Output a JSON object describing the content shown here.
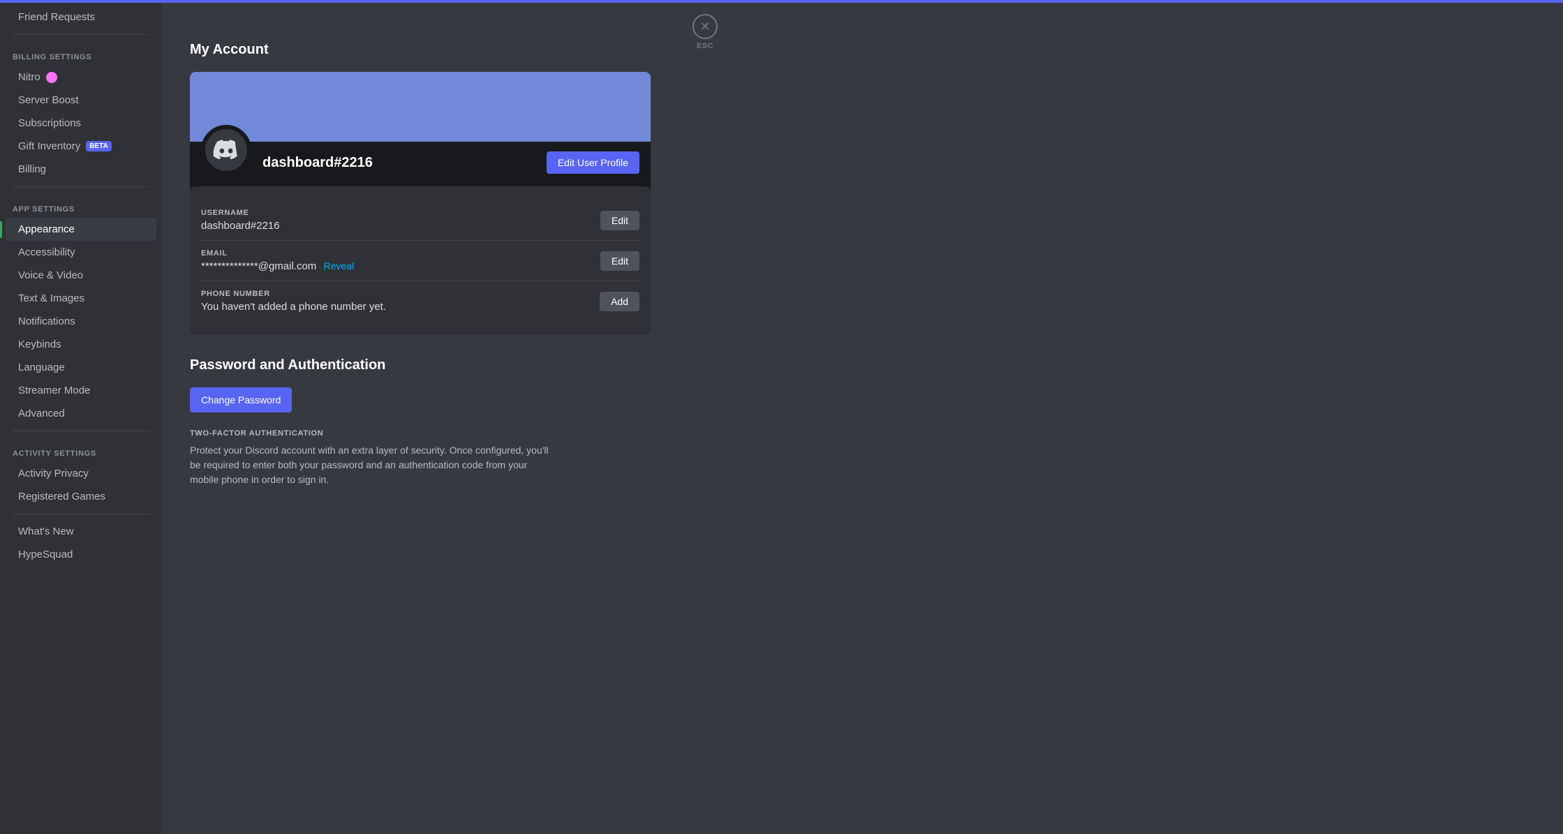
{
  "topbar": {
    "color": "#5865f2"
  },
  "sidebar": {
    "friend_requests": "Friend Requests",
    "billing_section": "Billing Settings",
    "nitro": "Nitro",
    "server_boost": "Server Boost",
    "subscriptions": "Subscriptions",
    "gift_inventory": "Gift Inventory",
    "beta_label": "BETA",
    "billing": "Billing",
    "app_section": "App Settings",
    "appearance": "Appearance",
    "accessibility": "Accessibility",
    "voice_video": "Voice & Video",
    "text_images": "Text & Images",
    "notifications": "Notifications",
    "keybinds": "Keybinds",
    "language": "Language",
    "streamer_mode": "Streamer Mode",
    "advanced": "Advanced",
    "activity_section": "Activity Settings",
    "activity_privacy": "Activity Privacy",
    "registered_games": "Registered Games",
    "whats_new": "What's New",
    "hypesquad": "HypeSquad"
  },
  "main": {
    "page_title": "My Account",
    "username": "dashboard#2216",
    "edit_profile_btn": "Edit User Profile",
    "fields": {
      "username_label": "USERNAME",
      "username_value": "dashboard#2216",
      "username_edit": "Edit",
      "email_label": "EMAIL",
      "email_value": "**************@gmail.com",
      "email_reveal": "Reveal",
      "email_edit": "Edit",
      "phone_label": "PHONE NUMBER",
      "phone_value": "You haven't added a phone number yet.",
      "phone_add": "Add"
    },
    "password_section": {
      "title": "Password and Authentication",
      "change_password_btn": "Change Password",
      "two_factor_label": "TWO-FACTOR AUTHENTICATION",
      "two_factor_desc": "Protect your Discord account with an extra layer of security. Once configured, you'll be required to enter both your password and an authentication code from your mobile phone in order to sign in."
    },
    "close_btn_label": "ESC"
  }
}
